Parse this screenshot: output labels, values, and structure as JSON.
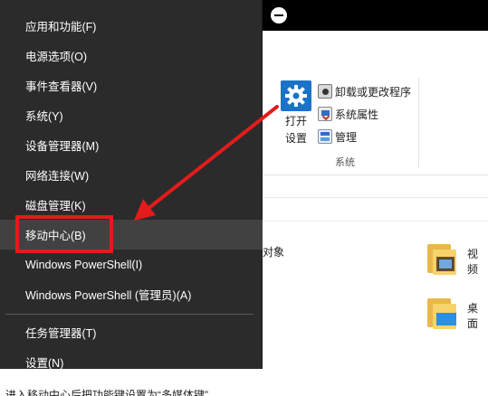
{
  "menu": {
    "items": [
      {
        "label": "应用和功能(F)"
      },
      {
        "label": "电源选项(O)"
      },
      {
        "label": "事件查看器(V)"
      },
      {
        "label": "系统(Y)"
      },
      {
        "label": "设备管理器(M)"
      },
      {
        "label": "网络连接(W)"
      },
      {
        "label": "磁盘管理(K)"
      },
      {
        "label": "移动中心(B)"
      },
      {
        "label": "Windows PowerShell(I)"
      },
      {
        "label": "Windows PowerShell (管理员)(A)"
      },
      {
        "label": "任务管理器(T)"
      },
      {
        "label": "设置(N)"
      }
    ]
  },
  "ribbon": {
    "open_settings_line1": "打开",
    "open_settings_line2": "设置",
    "uninstall": "卸载或更改程序",
    "system_properties": "系统属性",
    "manage": "管理",
    "group_label": "系统"
  },
  "content": {
    "objects_fragment": "对象",
    "folders": [
      {
        "name": "视频"
      },
      {
        "name": "桌面"
      }
    ]
  },
  "caption": "进入移动中心后把功能键设置为“多媒体键”",
  "colors": {
    "menu_bg": "#2b2b2b",
    "highlight": "#e31b1b",
    "accent": "#1a73c7"
  }
}
